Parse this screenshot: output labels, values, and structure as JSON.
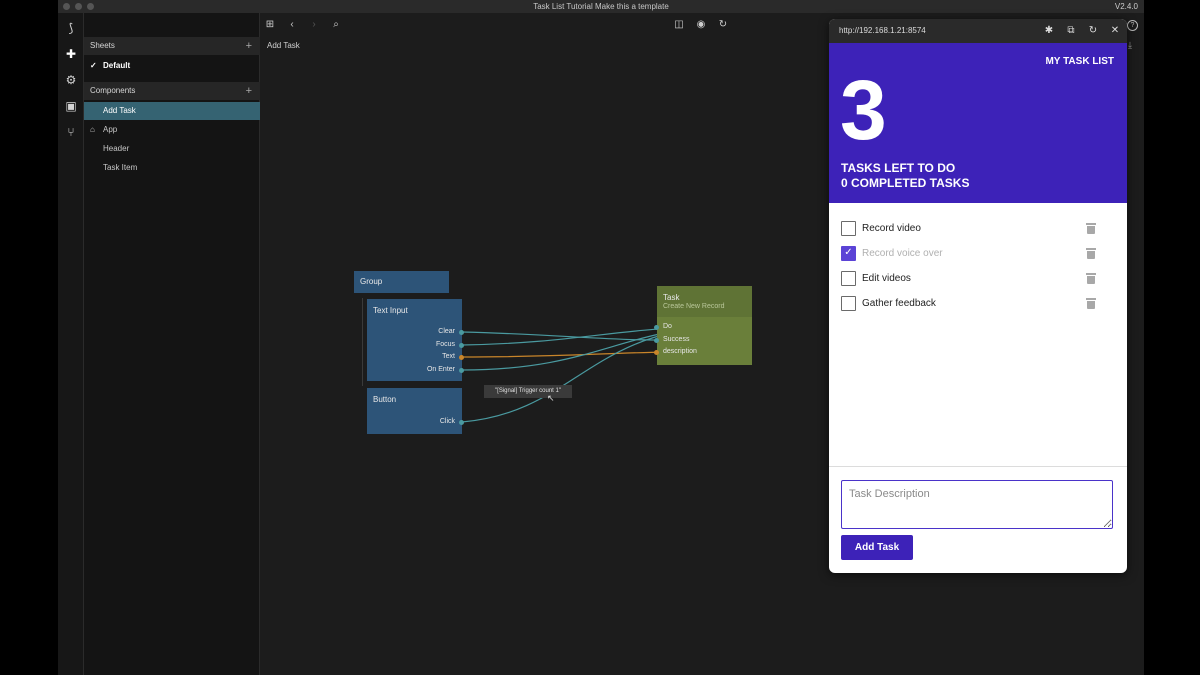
{
  "window": {
    "title": "Task List Tutorial Make this a template",
    "version": "V2.4.0"
  },
  "sheets": {
    "header": "Sheets",
    "items": [
      {
        "label": "Default"
      }
    ]
  },
  "components": {
    "header": "Components",
    "items": [
      {
        "label": "Add Task"
      },
      {
        "label": "App"
      },
      {
        "label": "Header"
      },
      {
        "label": "Task Item"
      }
    ]
  },
  "canvas": {
    "breadcrumb": "Add Task",
    "tooltip": "\"[Signal] Trigger count 1\"",
    "nodes": {
      "group": {
        "title": "Group"
      },
      "text_input": {
        "title": "Text Input",
        "ports": [
          "Clear",
          "Focus",
          "Text",
          "On Enter"
        ]
      },
      "button": {
        "title": "Button",
        "ports": [
          "Click"
        ]
      },
      "task": {
        "title": "Task",
        "subtitle": "Create New Record",
        "ports": [
          "Do",
          "Success",
          "description"
        ]
      }
    }
  },
  "preview": {
    "url": "http://192.168.1.21:8574",
    "app_title": "MY TASK LIST",
    "count": "3",
    "tasks_left": "TASKS LEFT TO DO",
    "completed": "0 COMPLETED TASKS",
    "tasks": [
      {
        "label": "Record video",
        "checked": false
      },
      {
        "label": "Record voice over",
        "checked": true
      },
      {
        "label": "Edit videos",
        "checked": false
      },
      {
        "label": "Gather feedback",
        "checked": false
      }
    ],
    "input_placeholder": "Task Description",
    "add_button": "Add Task"
  },
  "colors": {
    "accent": "#3d22b8",
    "node_blue": "#2d5478",
    "node_green": "#6a7f3a",
    "wire_teal": "#4a9aa0",
    "wire_orange": "#c9852a"
  }
}
